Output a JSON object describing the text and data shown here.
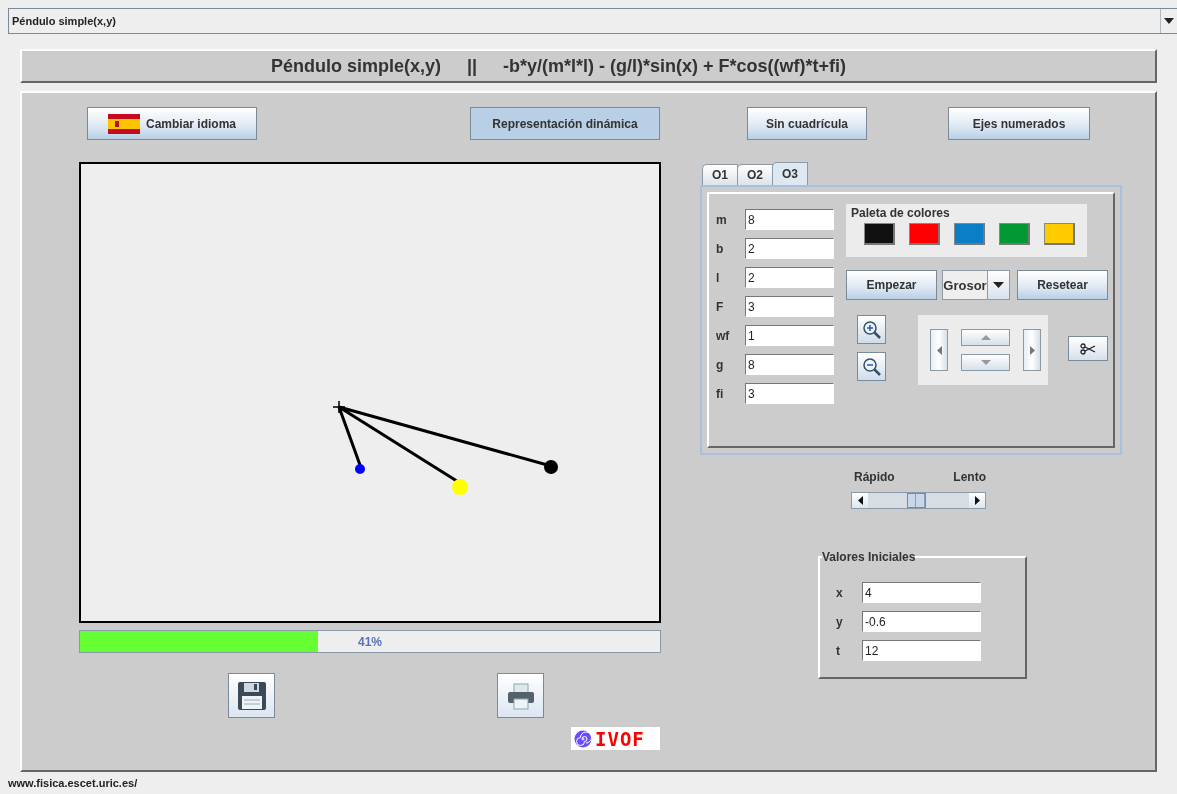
{
  "window_selector": {
    "value": "Péndulo simple(x,y)"
  },
  "title_bar": {
    "title": "Péndulo simple(x,y)",
    "separator": "||",
    "equation": "-b*y/(m*l*l) - (g/l)*sin(x) + F*cos((wf)*t+fi)"
  },
  "toolbar": [
    {
      "label": "Cambiar idioma",
      "kind": "flag",
      "pressed": false
    },
    {
      "label": "Representación dinámica",
      "kind": "plain",
      "pressed": true
    },
    {
      "label": "Sin cuadrícula",
      "kind": "plain",
      "pressed": false
    },
    {
      "label": "Ejes numerados",
      "kind": "plain",
      "pressed": false
    }
  ],
  "progress": {
    "level": 0.41,
    "text": "41%"
  },
  "tabs": [
    {
      "label": "O1",
      "selected": false
    },
    {
      "label": "O2",
      "selected": false
    },
    {
      "label": "O3",
      "selected": true
    }
  ],
  "parameters": [
    {
      "label": "m",
      "value": "8"
    },
    {
      "label": "b",
      "value": "2"
    },
    {
      "label": "l",
      "value": "2"
    },
    {
      "label": "F",
      "value": "3"
    },
    {
      "label": "wf",
      "value": "1"
    },
    {
      "label": "g",
      "value": "8"
    },
    {
      "label": "fi",
      "value": "3"
    }
  ],
  "palette": {
    "title": "Paleta de colores",
    "colors": [
      {
        "color": "#111111"
      },
      {
        "color": "#ff0000"
      },
      {
        "color": "#0a7fc8"
      },
      {
        "color": "#009933"
      },
      {
        "color": "#ffcc00"
      }
    ]
  },
  "actions": [
    {
      "kind": "button",
      "label": "Empezar"
    },
    {
      "kind": "combo",
      "label": "Grosor"
    },
    {
      "kind": "button",
      "label": "Resetear"
    }
  ],
  "speed": {
    "fast_label": "Rápido",
    "slow_label": "Lento",
    "level": 0.47
  },
  "initial_values": {
    "title": "Valores Iniciales",
    "fields": [
      {
        "label": "x",
        "value": "4"
      },
      {
        "label": "y",
        "value": "-0.6"
      },
      {
        "label": "t",
        "value": "12"
      }
    ]
  },
  "logo": {
    "text": "IVOF"
  },
  "footer": {
    "url": "www.fisica.escet.uric.es/"
  }
}
